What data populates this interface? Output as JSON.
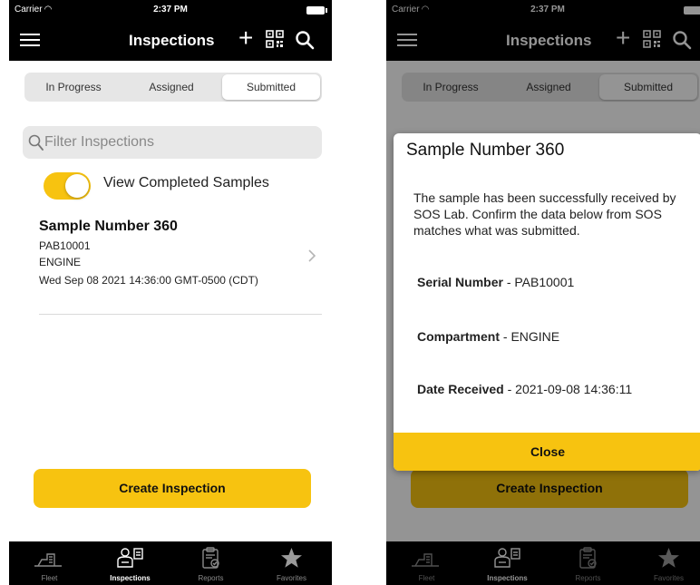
{
  "status": {
    "carrier": "Carrier",
    "time": "2:37 PM"
  },
  "navbar": {
    "title": "Inspections",
    "add_symbol": "+"
  },
  "segments": [
    "In Progress",
    "Assigned",
    "Submitted"
  ],
  "filter": {
    "placeholder": "Filter Inspections"
  },
  "toggle": {
    "label": "View Completed Samples",
    "on": true
  },
  "list": {
    "items": [
      {
        "title": "Sample Number 360",
        "serial": "PAB10001",
        "compartment": "ENGINE",
        "date": "Wed Sep 08 2021 14:36:00 GMT-0500 (CDT)"
      }
    ]
  },
  "create_button": "Create Inspection",
  "tabs": [
    {
      "label": "Fleet",
      "icon": "fleet-icon"
    },
    {
      "label": "Inspections",
      "icon": "inspections-icon",
      "active": true
    },
    {
      "label": "Reports",
      "icon": "reports-icon"
    },
    {
      "label": "Favorites",
      "icon": "star-icon"
    }
  ],
  "modal": {
    "title": "Sample Number 360",
    "body": "The sample has been successfully received by SOS Lab. Confirm the data below from SOS matches what was submitted.",
    "fields": [
      {
        "label": "Serial Number",
        "value": " - PAB10001"
      },
      {
        "label": "Compartment",
        "value": " - ENGINE"
      },
      {
        "label": "Date Received",
        "value": " - 2021-09-08 14:36:11"
      }
    ],
    "close_label": "Close"
  },
  "colors": {
    "accent": "#f7c310",
    "bar": "#000000"
  }
}
